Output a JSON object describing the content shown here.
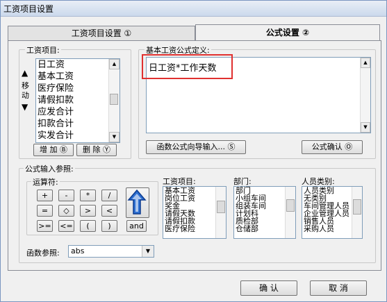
{
  "window": {
    "title": "工资项目设置"
  },
  "tabs": [
    {
      "label": "工资项目设置 ①"
    },
    {
      "label": "公式设置 ②"
    }
  ],
  "salary_items": {
    "group_label": "工资项目:",
    "move_label": "移动",
    "items": [
      "日工资",
      "基本工资",
      "医疗保险",
      "请假扣款",
      "应发合计",
      "扣款合计",
      "实发合计"
    ],
    "add_button": "增 加 Ⓑ",
    "delete_button": "删 除 Ⓨ"
  },
  "formula": {
    "group_label": "基本工资公式定义:",
    "value": "日工资*工作天数",
    "wizard_button": "函数公式向导输入... Ⓢ",
    "confirm_button": "公式确认 Ⓞ"
  },
  "reference": {
    "group_label": "公式输入参照:",
    "operators_label": "运算符:",
    "operators": [
      "+",
      "-",
      "*",
      "/",
      "=",
      "◇",
      ">",
      "<",
      ">=",
      "<=",
      "(",
      ")",
      "and"
    ],
    "salary_items_label": "工资项目:",
    "salary_items": [
      "基本工资",
      "岗位工资",
      "奖金",
      "请假天数",
      "请假扣款",
      "医疗保险"
    ],
    "department_label": "部门:",
    "departments": [
      "部门",
      "小组车间",
      "组装车间",
      "计划科",
      "质检部",
      "仓储部"
    ],
    "staff_type_label": "人员类别:",
    "staff_types": [
      "人员类别",
      "无类别",
      "车间管理人员",
      "企业管理人员",
      "销售人员",
      "采购人员"
    ],
    "function_label": "函数参照:",
    "function_value": "abs"
  },
  "footer": {
    "ok_button": "确 认",
    "cancel_button": "取 消"
  }
}
